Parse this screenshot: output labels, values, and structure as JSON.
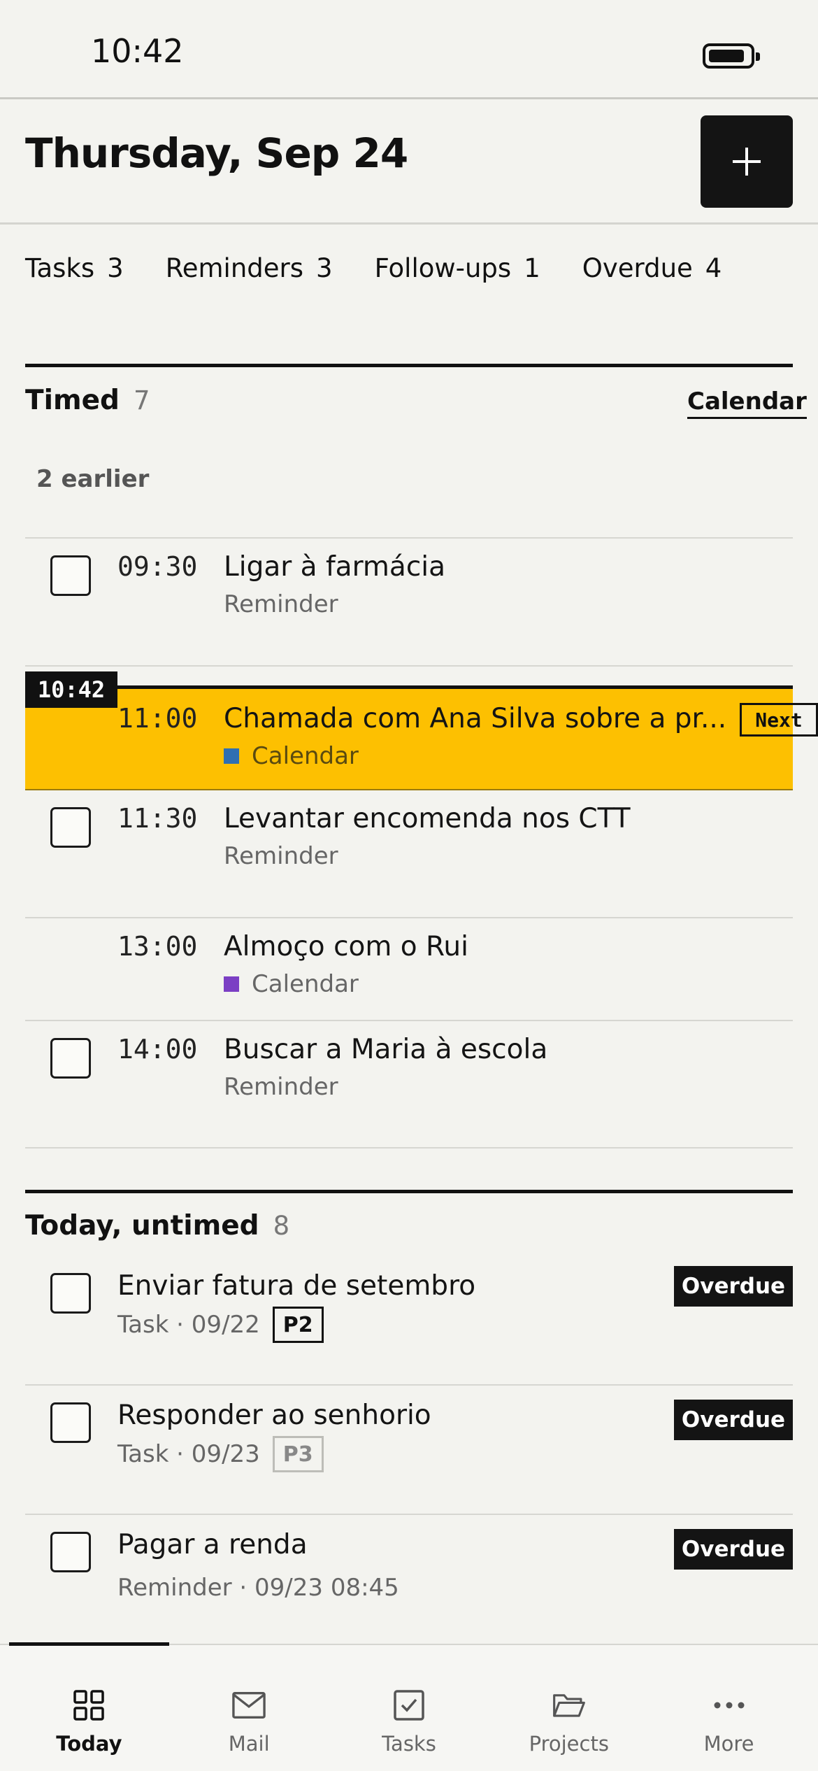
{
  "status_bar": {
    "time": "10:42"
  },
  "header": {
    "title": "Thursday, Sep 24"
  },
  "counts": [
    {
      "label": "Tasks",
      "value": "3"
    },
    {
      "label": "Reminders",
      "value": "3"
    },
    {
      "label": "Follow-ups",
      "value": "1"
    },
    {
      "label": "Overdue",
      "value": "4"
    }
  ],
  "timed": {
    "title": "Timed",
    "count": "7",
    "calendar_link": "Calendar",
    "earlier_label": "2 earlier",
    "now_time": "10:42",
    "items": [
      {
        "time": "09:30",
        "title": "Ligar à farmácia",
        "kind": "Reminder"
      },
      {
        "time": "11:00",
        "title": "Chamada com Ana Silva sobre a pr...",
        "kind": "Calendar",
        "badge": "Next",
        "color": "#2f6fb2"
      },
      {
        "time": "11:30",
        "title": "Levantar encomenda nos CTT",
        "kind": "Reminder"
      },
      {
        "time": "13:00",
        "title": "Almoço com o Rui",
        "kind": "Calendar",
        "color": "#7b3fc4"
      },
      {
        "time": "14:00",
        "title": "Buscar a Maria à escola",
        "kind": "Reminder"
      }
    ]
  },
  "untimed": {
    "title": "Today, untimed",
    "count": "8",
    "items": [
      {
        "title": "Enviar fatura de setembro",
        "meta": "Task · 09/22",
        "priority": "P2",
        "status": "Overdue"
      },
      {
        "title": "Responder ao senhorio",
        "meta": "Task · 09/23",
        "priority": "P3",
        "status": "Overdue"
      },
      {
        "title": "Pagar a renda",
        "meta": "Reminder · 09/23 08:45",
        "status": "Overdue"
      }
    ]
  },
  "tabs": [
    {
      "label": "Today",
      "icon": "grid-icon"
    },
    {
      "label": "Mail",
      "icon": "mail-icon"
    },
    {
      "label": "Tasks",
      "icon": "checkbox-icon"
    },
    {
      "label": "Projects",
      "icon": "folder-icon"
    },
    {
      "label": "More",
      "icon": "more-dots-icon"
    }
  ],
  "colors": {
    "accent_now": "#fdc001",
    "dark": "#141414",
    "background": "#f3f3ef"
  }
}
